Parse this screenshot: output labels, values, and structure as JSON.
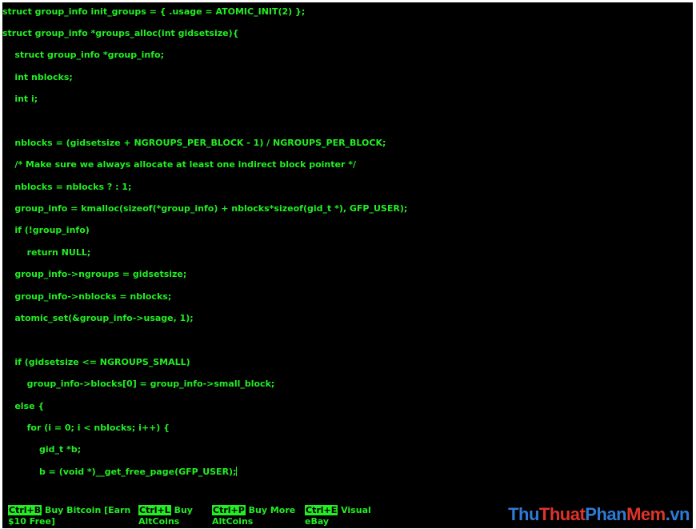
{
  "colors": {
    "terminal_background": "#000000",
    "text": "#22ee22",
    "key_highlight_background": "#22ee22",
    "key_highlight_text": "#000000",
    "watermark_blue": "#2e7bd6",
    "watermark_red": "#e0332b"
  },
  "code": {
    "lines": [
      "struct group_info init_groups = { .usage = ATOMIC_INIT(2) };",
      "struct group_info *groups_alloc(int gidsetsize){",
      "    struct group_info *group_info;",
      "    int nblocks;",
      "    int i;",
      "",
      "    nblocks = (gidsetsize + NGROUPS_PER_BLOCK - 1) / NGROUPS_PER_BLOCK;",
      "    /* Make sure we always allocate at least one indirect block pointer */",
      "    nblocks = nblocks ? : 1;",
      "    group_info = kmalloc(sizeof(*group_info) + nblocks*sizeof(gid_t *), GFP_USER);",
      "    if (!group_info)",
      "        return NULL;",
      "    group_info->ngroups = gidsetsize;",
      "    group_info->nblocks = nblocks;",
      "    atomic_set(&group_info->usage, 1);",
      "",
      "    if (gidsetsize <= NGROUPS_SMALL)",
      "        group_info->blocks[0] = group_info->small_block;",
      "    else {",
      "        for (i = 0; i < nblocks; i++) {",
      "            gid_t *b;",
      "            b = (void *)__get_free_page(GFP_USER);"
    ]
  },
  "footer": {
    "shortcuts": [
      {
        "key": "Ctrl+B",
        "line1": " Buy Bitcoin [Earn",
        "line2": "$10 Free]"
      },
      {
        "key": "Ctrl+L",
        "line1": " Buy",
        "line2": "AltCoins"
      },
      {
        "key": "Ctrl+P",
        "line1": " Buy More",
        "line2": "AltCoins"
      },
      {
        "key": "Ctrl+E",
        "line1": " Visual",
        "line2": "eBay"
      }
    ]
  },
  "watermark": {
    "part1": "Thu",
    "part2": "Thuat",
    "part3": "Phan",
    "part4": "Mem",
    "part5": ".vn"
  }
}
